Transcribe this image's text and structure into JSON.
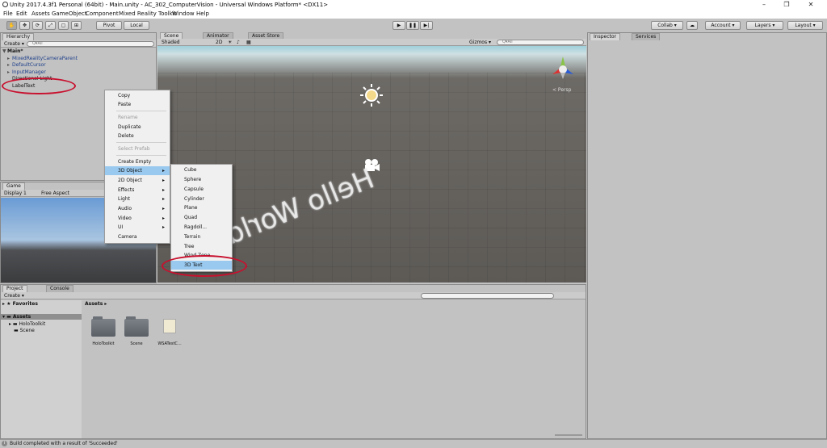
{
  "window": {
    "title": "Unity 2017.4.3f1 Personal (64bit) - Main.unity - AC_302_ComputerVision - Universal Windows Platform* <DX11>",
    "minimize": "–",
    "maximize": "❐",
    "close": "✕"
  },
  "menu": [
    "File",
    "Edit",
    "Assets",
    "GameObject",
    "Component",
    "Mixed Reality Toolkit",
    "Window",
    "Help"
  ],
  "toolbar": {
    "pivot": "Pivot",
    "local": "Local",
    "collab": "Collab ▾",
    "account": "Account ▾",
    "layers": "Layers ▾",
    "layout": "Layout ▾"
  },
  "hierarchy": {
    "tab": "Hierarchy",
    "create": "Create ▾",
    "search": "Q▾All",
    "scene": "Main*",
    "items": [
      "MixedRealityCameraParent",
      "DefaultCursor",
      "InputManager",
      "Directional Light",
      "LabelText"
    ]
  },
  "scene_tabs": [
    "Scene",
    "Animator",
    "Asset Store"
  ],
  "scene_toolbar": {
    "shading": "Shaded",
    "mode": "2D",
    "gizmos": "Gizmos ▾",
    "search": "Q▾All"
  },
  "scene_view": {
    "persp": "< Persp",
    "text_3d": "Hello World"
  },
  "game": {
    "tab": "Game",
    "display": "Display 1",
    "aspect": "Free Aspect"
  },
  "inspector": {
    "tab": "Inspector",
    "services": "Services"
  },
  "context_menu": {
    "items": [
      "Copy",
      "Paste",
      "Rename",
      "Duplicate",
      "Delete",
      "Select Prefab",
      "Create Empty",
      "3D Object",
      "2D Object",
      "Effects",
      "Light",
      "Audio",
      "Video",
      "UI",
      "Camera"
    ]
  },
  "submenu": {
    "items": [
      "Cube",
      "Sphere",
      "Capsule",
      "Cylinder",
      "Plane",
      "Quad",
      "Ragdoll...",
      "Terrain",
      "Tree",
      "Wind Zone",
      "3D Text"
    ]
  },
  "project": {
    "tab": "Project",
    "console": "Console",
    "create": "Create ▾",
    "favorites": "Favorites",
    "assets": "Assets",
    "tree": [
      "HoloToolkit",
      "Scene"
    ],
    "breadcrumb": "Assets ▸",
    "files": [
      "HoloToolkit",
      "Scene",
      "WSATestC..."
    ]
  },
  "status": {
    "text": "Build completed with a result of 'Succeeded'"
  }
}
